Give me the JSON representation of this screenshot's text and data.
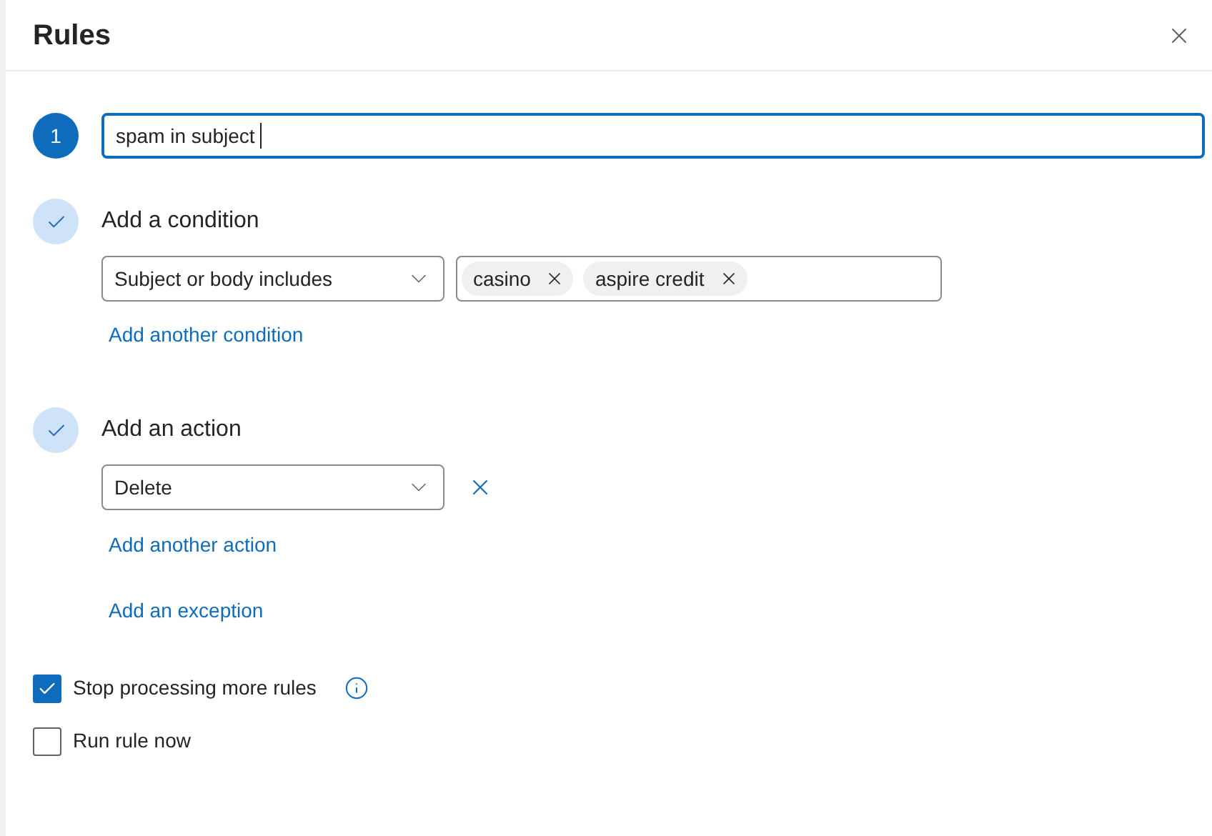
{
  "dialog": {
    "title": "Rules"
  },
  "rule_name": {
    "step": "1",
    "value": "spam in subject"
  },
  "condition": {
    "title": "Add a condition",
    "completed": true,
    "type": "Subject or body includes",
    "keywords": [
      "casino",
      "aspire credit"
    ],
    "link": "Add another condition"
  },
  "action": {
    "title": "Add an action",
    "completed": true,
    "type": "Delete",
    "link": "Add another action"
  },
  "exception_link": "Add an exception",
  "options": [
    {
      "label": "Stop processing more rules",
      "checked": true,
      "info": true
    },
    {
      "label": "Run rule now",
      "checked": false,
      "info": false
    }
  ]
}
